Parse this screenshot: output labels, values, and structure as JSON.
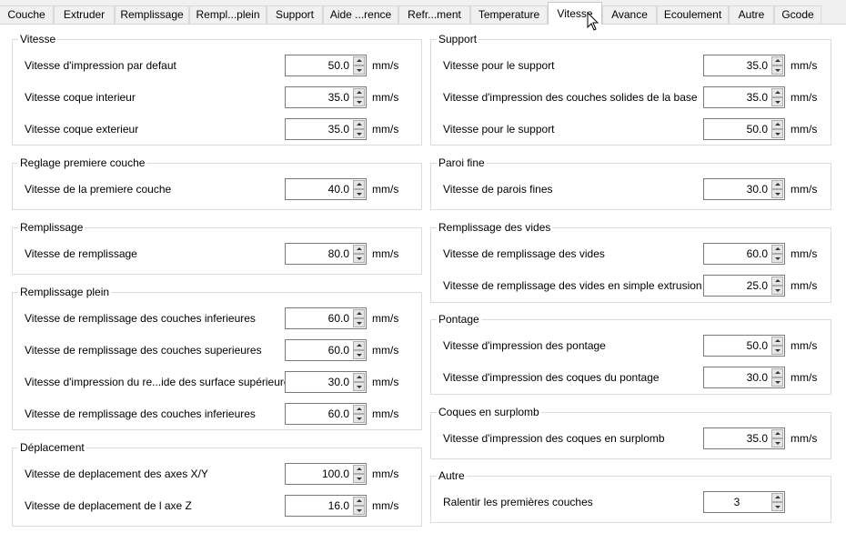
{
  "tabs": [
    {
      "label": "Couche"
    },
    {
      "label": "Extruder"
    },
    {
      "label": "Remplissage"
    },
    {
      "label": "Rempl...plein"
    },
    {
      "label": "Support"
    },
    {
      "label": "Aide ...rence"
    },
    {
      "label": "Refr...ment"
    },
    {
      "label": "Temperature"
    },
    {
      "label": "Vitesse"
    },
    {
      "label": "Avance"
    },
    {
      "label": "Ecoulement"
    },
    {
      "label": "Autre"
    },
    {
      "label": "Gcode"
    }
  ],
  "active_tab": "Vitesse",
  "left": {
    "vitesse": {
      "title": "Vitesse",
      "rows": [
        {
          "label": "Vitesse d'impression par defaut",
          "value": "50.0",
          "unit": "mm/s"
        },
        {
          "label": "Vitesse coque interieur",
          "value": "35.0",
          "unit": "mm/s"
        },
        {
          "label": "Vitesse coque exterieur",
          "value": "35.0",
          "unit": "mm/s"
        }
      ]
    },
    "premiere": {
      "title": "Reglage premiere couche",
      "rows": [
        {
          "label": "Vitesse de la premiere couche",
          "value": "40.0",
          "unit": "mm/s"
        }
      ]
    },
    "remplissage": {
      "title": "Remplissage",
      "rows": [
        {
          "label": "Vitesse de remplissage",
          "value": "80.0",
          "unit": "mm/s"
        }
      ]
    },
    "plein": {
      "title": "Remplissage plein",
      "rows": [
        {
          "label": "Vitesse de remplissage des couches inferieures",
          "value": "60.0",
          "unit": "mm/s"
        },
        {
          "label": "Vitesse de remplissage des couches superieures",
          "value": "60.0",
          "unit": "mm/s"
        },
        {
          "label": "Vitesse d'impression du re...ide des surface supérieure",
          "value": "30.0",
          "unit": "mm/s"
        },
        {
          "label": "Vitesse de remplissage des couches inferieures",
          "value": "60.0",
          "unit": "mm/s"
        }
      ]
    },
    "deplacement": {
      "title": "Déplacement",
      "rows": [
        {
          "label": "Vitesse de deplacement des axes X/Y",
          "value": "100.0",
          "unit": "mm/s"
        },
        {
          "label": "Vitesse de deplacement de l axe Z",
          "value": "16.0",
          "unit": "mm/s"
        }
      ]
    }
  },
  "right": {
    "support": {
      "title": "Support",
      "rows": [
        {
          "label": "Vitesse pour le support",
          "value": "35.0",
          "unit": "mm/s"
        },
        {
          "label": "Vitesse d'impression des couches solides de la base",
          "value": "35.0",
          "unit": "mm/s"
        },
        {
          "label": "Vitesse pour le support",
          "value": "50.0",
          "unit": "mm/s"
        }
      ]
    },
    "paroi": {
      "title": "Paroi fine",
      "rows": [
        {
          "label": "Vitesse de parois fines",
          "value": "30.0",
          "unit": "mm/s"
        }
      ]
    },
    "vides": {
      "title": "Remplissage des vides",
      "rows": [
        {
          "label": "Vitesse de remplissage des vides",
          "value": "60.0",
          "unit": "mm/s"
        },
        {
          "label": "Vitesse de remplissage des vides en simple extrusion",
          "value": "25.0",
          "unit": "mm/s"
        }
      ]
    },
    "pontage": {
      "title": "Pontage",
      "rows": [
        {
          "label": "Vitesse d'impression des pontage",
          "value": "50.0",
          "unit": "mm/s"
        },
        {
          "label": "Vitesse d'impression des coques du pontage",
          "value": "30.0",
          "unit": "mm/s"
        }
      ]
    },
    "surplomb": {
      "title": "Coques en surplomb",
      "rows": [
        {
          "label": "Vitesse d'impression des coques en surplomb",
          "value": "35.0",
          "unit": "mm/s"
        }
      ]
    },
    "autre": {
      "title": "Autre",
      "rows": [
        {
          "label": "Ralentir les premières couches",
          "value": "3",
          "unit": ""
        }
      ]
    }
  }
}
